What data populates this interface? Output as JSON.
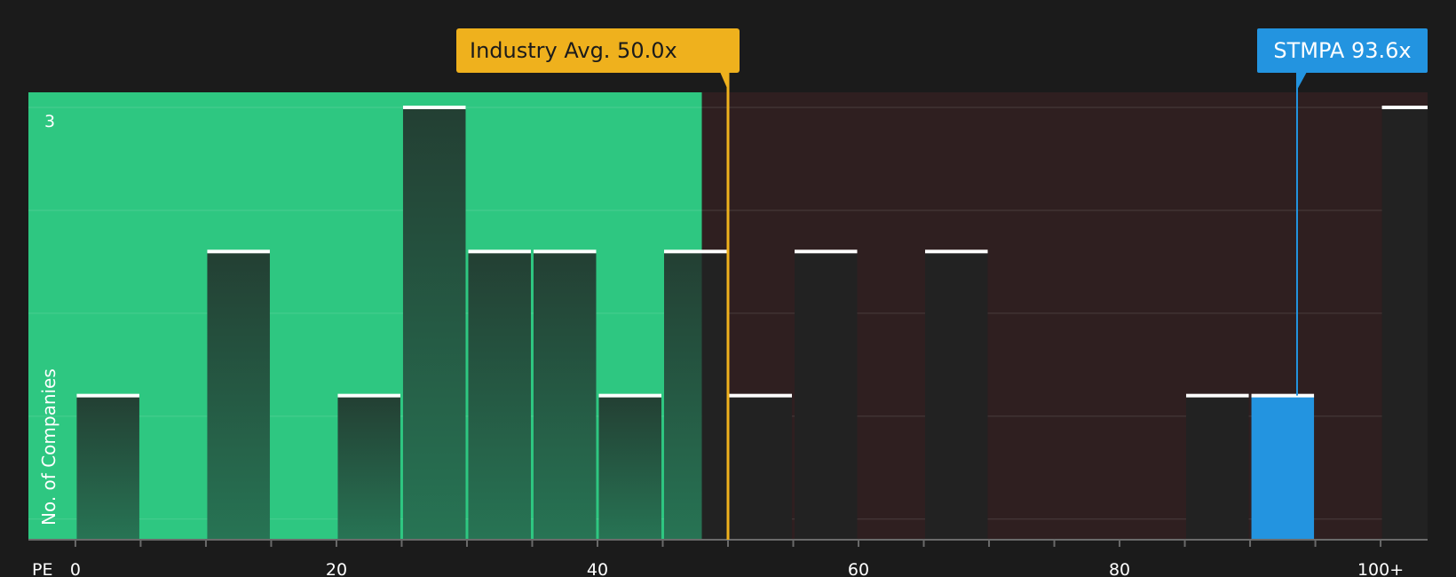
{
  "chart_data": {
    "type": "bar",
    "ylabel": "No. of Companies",
    "y_tick_label": "3",
    "ylim": [
      0,
      3
    ],
    "x_axis_label": "PE",
    "x_ticks": [
      "0",
      "20",
      "40",
      "60",
      "80",
      "100+"
    ],
    "xlim": [
      -3.6,
      103.6
    ],
    "bin_width": 5,
    "bins": [
      {
        "start": 0,
        "count": 1
      },
      {
        "start": 10,
        "count": 2
      },
      {
        "start": 20,
        "count": 1
      },
      {
        "start": 25,
        "count": 3
      },
      {
        "start": 30,
        "count": 2
      },
      {
        "start": 35,
        "count": 2
      },
      {
        "start": 40,
        "count": 1
      },
      {
        "start": 45,
        "count": 2
      },
      {
        "start": 50,
        "count": 1
      },
      {
        "start": 55,
        "count": 2
      },
      {
        "start": 65,
        "count": 2
      },
      {
        "start": 85,
        "count": 1
      },
      {
        "start": 90,
        "count": 1,
        "highlight": true
      },
      {
        "start": 100,
        "count": 3
      }
    ],
    "fair_range_end": 48.0,
    "industry_avg": {
      "label": "Industry Avg. 50.0x",
      "value": 50.0
    },
    "company": {
      "label": "STMPA 93.6x",
      "value": 93.6
    },
    "colors": {
      "background": "#1b1b1b",
      "fair_zone": "#2ec781",
      "over_zone": "#2f1f20",
      "bar_in_fair": "#23473a",
      "bar_in_over": "#222222",
      "highlight_bar": "#2394e0",
      "industry": "#efb11d",
      "company": "#2394e0",
      "bar_cap": "#ffffff"
    }
  }
}
